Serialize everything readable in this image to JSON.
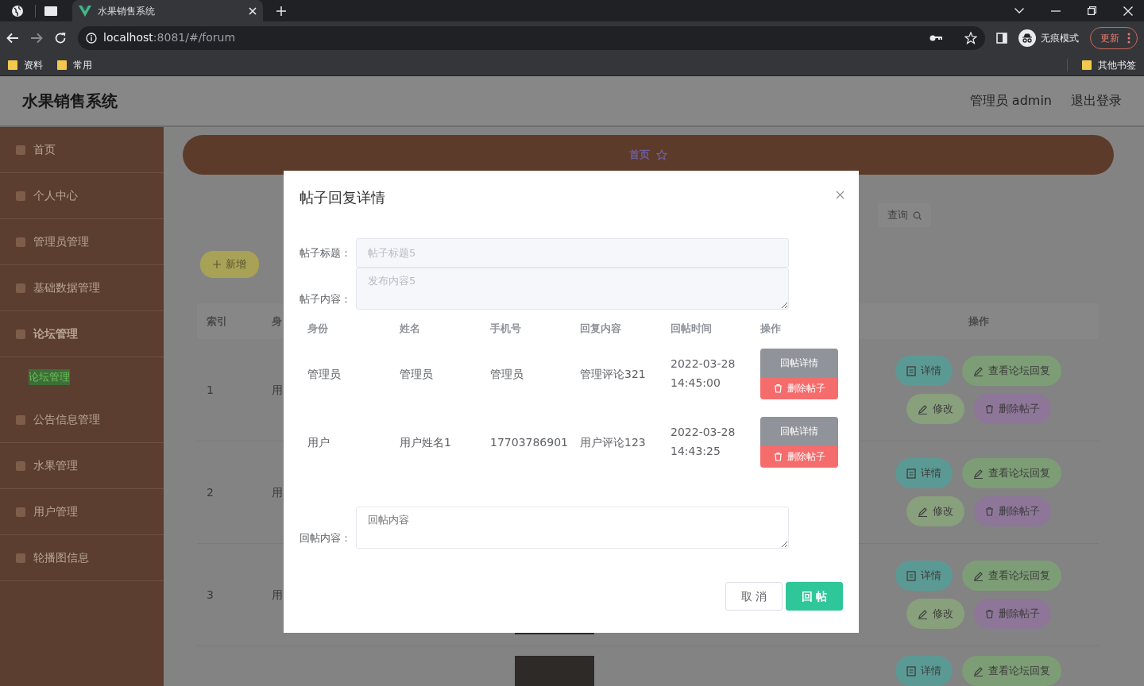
{
  "browser": {
    "tab_title": "水果销售系统",
    "url_host": "localhost",
    "url_path": ":8081/#/forum",
    "profile": "无痕模式",
    "update": "更新",
    "bookmarks": [
      "资料",
      "常用"
    ],
    "other_bookmarks": "其他书签"
  },
  "header": {
    "title": "水果销售系统",
    "user": "管理员 admin",
    "logout": "退出登录"
  },
  "sidebar": {
    "items": [
      {
        "label": "首页"
      },
      {
        "label": "个人中心"
      },
      {
        "label": "管理员管理"
      },
      {
        "label": "基础数据管理"
      },
      {
        "label": "论坛管理",
        "expanded": true,
        "children": [
          {
            "label": "论坛管理",
            "selected": true
          }
        ]
      },
      {
        "label": "公告信息管理"
      },
      {
        "label": "水果管理"
      },
      {
        "label": "用户管理"
      },
      {
        "label": "轮播图信息"
      }
    ]
  },
  "breadcrumb": {
    "home": "首页"
  },
  "search_button": "查询",
  "add_button": "新增",
  "table": {
    "columns": [
      "索引",
      "身"
    ],
    "action_column": "操作",
    "rows": [
      {
        "index": "1",
        "role": "用",
        "photo": false,
        "actions": [
          {
            "label": "详情",
            "kind": "details"
          },
          {
            "label": "查看论坛回复",
            "kind": "replies"
          },
          {
            "label": "修改",
            "kind": "edit"
          },
          {
            "label": "删除帖子",
            "kind": "delete"
          }
        ]
      },
      {
        "index": "2",
        "role": "用",
        "photo": false,
        "actions": [
          {
            "label": "详情",
            "kind": "details"
          },
          {
            "label": "查看论坛回复",
            "kind": "replies"
          },
          {
            "label": "修改",
            "kind": "edit"
          },
          {
            "label": "删除帖子",
            "kind": "delete"
          }
        ]
      },
      {
        "index": "3",
        "role": "用",
        "photo": true,
        "actions": [
          {
            "label": "详情",
            "kind": "details"
          },
          {
            "label": "查看论坛回复",
            "kind": "replies"
          },
          {
            "label": "修改",
            "kind": "edit"
          },
          {
            "label": "删除帖子",
            "kind": "delete"
          }
        ]
      },
      {
        "photo": true,
        "actions": [
          {
            "label": "详情",
            "kind": "details"
          },
          {
            "label": "查看论坛回复",
            "kind": "replies"
          }
        ]
      }
    ]
  },
  "modal": {
    "title": "帖子回复详情",
    "fields": [
      {
        "label": "帖子标题：",
        "value": "帖子标题5",
        "kind": "input",
        "disabled": true
      },
      {
        "label": "帖子内容：",
        "value": "发布内容5",
        "kind": "textarea",
        "disabled": true
      }
    ],
    "columns": [
      "身份",
      "姓名",
      "手机号",
      "回复内容",
      "回帖时间",
      "操作"
    ],
    "rows": [
      {
        "role": "管理员",
        "name": "管理员",
        "phone": "管理员",
        "content": "管理评论321",
        "time": "2022-03-28 14:45:00",
        "actions": [
          {
            "label": "回帖详情",
            "kind": "details"
          },
          {
            "label": "删除帖子",
            "kind": "delete"
          }
        ]
      },
      {
        "role": "用户",
        "name": "用户姓名1",
        "phone": "17703786901",
        "content": "用户评论123",
        "time": "2022-03-28 14:43:25",
        "actions": [
          {
            "label": "回帖详情",
            "kind": "details"
          },
          {
            "label": "删除帖子",
            "kind": "delete"
          }
        ]
      }
    ],
    "reply": {
      "label": "回帖内容：",
      "placeholder": "回帖内容"
    },
    "buttons": [
      {
        "label": "取 消",
        "kind": "cancel"
      },
      {
        "label": "回 帖",
        "kind": "primary"
      }
    ]
  }
}
